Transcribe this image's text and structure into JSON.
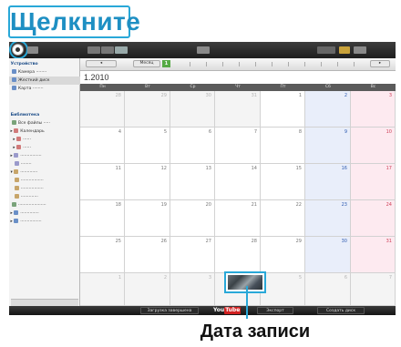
{
  "callouts": {
    "top": "Щелкните",
    "bottom": "Дата записи"
  },
  "calendar": {
    "title": "1.2010",
    "weekdays": [
      "Пн",
      "Вт",
      "Ср",
      "Чт",
      "Пт",
      "Сб",
      "Вс"
    ],
    "weeks": [
      [
        "28",
        "29",
        "30",
        "31",
        "1",
        "2",
        "3"
      ],
      [
        "4",
        "5",
        "6",
        "7",
        "8",
        "9",
        "10"
      ],
      [
        "11",
        "12",
        "13",
        "14",
        "15",
        "16",
        "17"
      ],
      [
        "18",
        "19",
        "20",
        "21",
        "22",
        "23",
        "24"
      ],
      [
        "25",
        "26",
        "27",
        "28",
        "29",
        "30",
        "31"
      ],
      [
        "1",
        "2",
        "3",
        "4",
        "5",
        "6",
        "7"
      ]
    ]
  },
  "toolbar": {
    "month_label": "Месяц",
    "month_badge": "1"
  },
  "bottombar": {
    "upload_label": "Загрузка завершена",
    "youtube_you": "You",
    "youtube_tube": "Tube",
    "export_label": "Экспорт",
    "create_disc_label": "Создать диск"
  },
  "colors": {
    "accent": "#29a8d8",
    "saturday_bg": "#e9eefa",
    "sunday_bg": "#fdeaf0"
  }
}
